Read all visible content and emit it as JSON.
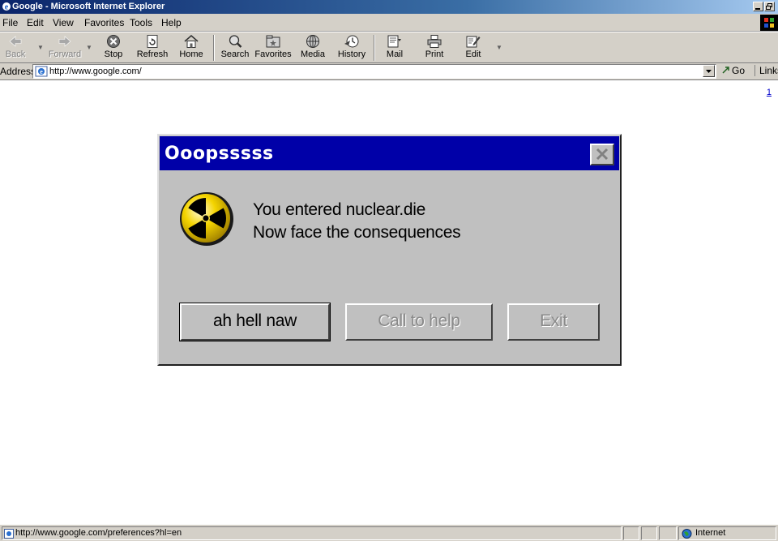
{
  "window": {
    "title": "Google - Microsoft Internet Explorer",
    "icons": [
      "ie-icon",
      "minimize-icon",
      "restore-icon"
    ]
  },
  "menubar": {
    "items": [
      "File",
      "Edit",
      "View",
      "Favorites",
      "Tools",
      "Help"
    ]
  },
  "toolbar": {
    "buttons": [
      {
        "label": "Back",
        "icon": "back-arrow-icon",
        "enabled": false
      },
      {
        "label": "Forward",
        "icon": "forward-arrow-icon",
        "enabled": false
      },
      {
        "label": "Stop",
        "icon": "stop-icon",
        "enabled": true
      },
      {
        "label": "Refresh",
        "icon": "refresh-icon",
        "enabled": true
      },
      {
        "label": "Home",
        "icon": "home-icon",
        "enabled": true
      },
      {
        "label": "Search",
        "icon": "search-icon",
        "enabled": true
      },
      {
        "label": "Favorites",
        "icon": "favorites-icon",
        "enabled": true
      },
      {
        "label": "Media",
        "icon": "media-icon",
        "enabled": true
      },
      {
        "label": "History",
        "icon": "history-icon",
        "enabled": true
      },
      {
        "label": "Mail",
        "icon": "mail-icon",
        "enabled": true
      },
      {
        "label": "Print",
        "icon": "print-icon",
        "enabled": true
      },
      {
        "label": "Edit",
        "icon": "edit-icon",
        "enabled": true
      }
    ]
  },
  "address": {
    "label": "Address",
    "url": "http://www.google.com/",
    "go_label": "Go",
    "links_label": "Links"
  },
  "content": {
    "corner_link": "1"
  },
  "dialog": {
    "title": "Ooopsssss",
    "message_line1": "You entered nuclear.die",
    "message_line2": "Now face the consequences",
    "icon": "radiation-icon",
    "buttons": [
      {
        "label": "ah hell naw",
        "enabled": true
      },
      {
        "label": "Call to help",
        "enabled": false
      },
      {
        "label": "Exit",
        "enabled": false
      }
    ],
    "colors": {
      "title_bg": "#0000a8",
      "body_bg": "#c0c0c0",
      "hazard_yellow": "#f4d400"
    }
  },
  "statusbar": {
    "text": "http://www.google.com/preferences?hl=en",
    "zone": "Internet"
  }
}
